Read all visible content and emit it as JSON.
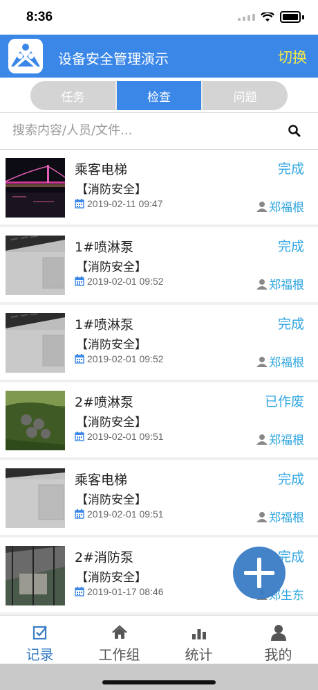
{
  "status_bar": {
    "time": "8:36"
  },
  "header": {
    "title": "设备安全管理演示",
    "switch_label": "切换"
  },
  "tabs": [
    {
      "label": "任务",
      "active": false
    },
    {
      "label": "检查",
      "active": true
    },
    {
      "label": "问题",
      "active": false
    }
  ],
  "search": {
    "placeholder": "搜索内容/人员/文件..."
  },
  "items": [
    {
      "title": "乘客电梯",
      "category": "【消防安全】",
      "date": "2019-02-11 09:47",
      "status": "完成",
      "user": "郑福根",
      "thumb": "bridge-night-photo"
    },
    {
      "title": "1#喷淋泵",
      "category": "【消防安全】",
      "date": "2019-02-01 09:52",
      "status": "完成",
      "user": "郑福根",
      "thumb": "laptop-photo"
    },
    {
      "title": "1#喷淋泵",
      "category": "【消防安全】",
      "date": "2019-02-01 09:52",
      "status": "完成",
      "user": "郑福根",
      "thumb": "laptop-photo"
    },
    {
      "title": "2#喷淋泵",
      "category": "【消防安全】",
      "date": "2019-02-01 09:51",
      "status": "已作废",
      "user": "郑福根",
      "thumb": "hillside-photo"
    },
    {
      "title": "乘客电梯",
      "category": "【消防安全】",
      "date": "2019-02-01 09:51",
      "status": "完成",
      "user": "郑福根",
      "thumb": "laptop-photo"
    },
    {
      "title": "2#消防泵",
      "category": "【消防安全】",
      "date": "2019-01-17 08:46",
      "status": "完成",
      "user": "郑生东",
      "thumb": "building-photo"
    }
  ],
  "fab": {
    "icon": "plus-icon"
  },
  "bottom_nav": [
    {
      "label": "记录",
      "icon": "checkbox-icon",
      "active": true
    },
    {
      "label": "工作组",
      "icon": "home-icon",
      "active": false
    },
    {
      "label": "统计",
      "icon": "bar-chart-icon",
      "active": false
    },
    {
      "label": "我的",
      "icon": "user-icon",
      "active": false
    }
  ],
  "colors": {
    "primary": "#3a87e8",
    "accent_text": "#2fa6e0",
    "switch_text": "#f3e84a"
  }
}
